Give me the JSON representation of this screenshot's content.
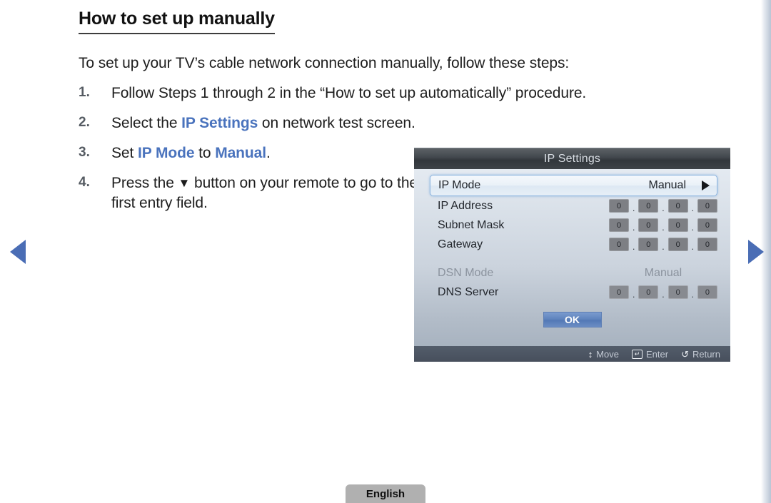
{
  "page": {
    "heading": "How to set up manually",
    "intro": "To set up your TV’s cable network connection manually, follow these steps:",
    "steps": [
      {
        "num": "1.",
        "text_before": "Follow Steps 1 through 2 in the “How to set up automatically” procedure.",
        "kw1": "",
        "text_mid": "",
        "kw2": "",
        "text_after": ""
      },
      {
        "num": "2.",
        "text_before": "Select the ",
        "kw1": "IP Settings",
        "text_mid": " on network test screen.",
        "kw2": "",
        "text_after": ""
      },
      {
        "num": "3.",
        "text_before": "Set ",
        "kw1": "IP Mode",
        "text_mid": " to ",
        "kw2": "Manual",
        "text_after": "."
      },
      {
        "num": "4.",
        "text_before": "Press the ",
        "kw1": "",
        "text_mid": "",
        "kw2": "",
        "text_after": " button on your remote to go to the first entry field.",
        "glyph": "▼"
      }
    ],
    "language_tab": "English"
  },
  "nav": {
    "prev_icon": "triangle-left",
    "next_icon": "triangle-right"
  },
  "osd": {
    "title": "IP Settings",
    "selected_row": {
      "label": "IP Mode",
      "value": "Manual",
      "chevron_icon": "triangle-right"
    },
    "fields": [
      {
        "label": "IP Address",
        "octets": [
          "0",
          "0",
          "0",
          "0"
        ],
        "separator": ".",
        "dimmed": false,
        "muted_boxes": false
      },
      {
        "label": "Subnet Mask",
        "octets": [
          "0",
          "0",
          "0",
          "0"
        ],
        "separator": ".",
        "dimmed": false,
        "muted_boxes": false
      },
      {
        "label": "Gateway",
        "octets": [
          "0",
          "0",
          "0",
          "0"
        ],
        "separator": ".",
        "dimmed": false,
        "muted_boxes": false
      }
    ],
    "dns_mode": {
      "label": "DSN Mode",
      "value": "Manual",
      "dimmed": true
    },
    "dns_server": {
      "label": "DNS Server",
      "octets": [
        "0",
        "0",
        "0",
        "0"
      ],
      "separator": ".",
      "dimmed": false,
      "muted_boxes": true
    },
    "ok_button": "OK",
    "hints": [
      {
        "icon": "↕",
        "label": "Move"
      },
      {
        "icon": "↵",
        "label": "Enter"
      },
      {
        "icon": "↺",
        "label": "Return"
      }
    ],
    "colors": {
      "accent_blue": "#4a73bd",
      "nav_arrow": "#4a6db5",
      "ok_button": "#5e83bd",
      "titlebar": "#3a3f45",
      "footer_bar": "#4a5360"
    }
  }
}
